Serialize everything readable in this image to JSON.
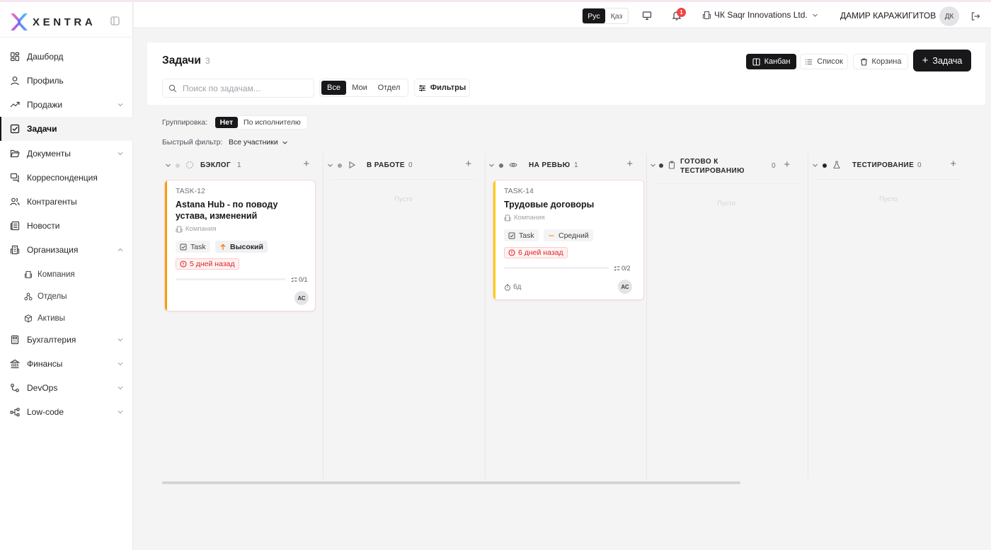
{
  "brand": {
    "name": "XENTRA"
  },
  "sidebar": {
    "items": [
      {
        "label": "Дашборд"
      },
      {
        "label": "Профиль"
      },
      {
        "label": "Продажи"
      },
      {
        "label": "Задачи"
      },
      {
        "label": "Документы"
      },
      {
        "label": "Корреспонденция"
      },
      {
        "label": "Контрагенты"
      },
      {
        "label": "Новости"
      },
      {
        "label": "Организация"
      },
      {
        "label": "Бухгалтерия"
      },
      {
        "label": "Финансы"
      },
      {
        "label": "DevOps"
      },
      {
        "label": "Low-code"
      }
    ],
    "org_sub": [
      {
        "label": "Компания"
      },
      {
        "label": "Отделы"
      },
      {
        "label": "Активы"
      }
    ],
    "active": "Задачи"
  },
  "header": {
    "lang_ru": "Рус",
    "lang_kz": "Қаз",
    "notifications": "1",
    "company": "ЧК Saqr Innovations Ltd.",
    "user": "ДАМИР КАРАЖИГИТОВ",
    "initials": "ДК"
  },
  "page": {
    "title": "Задачи",
    "count": "3",
    "search_placeholder": "Поиск по задачам...",
    "scope": {
      "all": "Все",
      "mine": "Мои",
      "dept": "Отдел"
    },
    "filters": "Фильтры",
    "views": {
      "kanban": "Канбан",
      "list": "Список",
      "trash": "Корзина"
    },
    "add_task": "Задача",
    "grouping_label": "Группировка:",
    "grouping": {
      "none": "Нет",
      "assignee": "По исполнителю"
    },
    "quick_label": "Быстрый фильтр:",
    "quick_value": "Все участники"
  },
  "columns": [
    {
      "name": "БЭКЛОГ",
      "count": "1"
    },
    {
      "name": "В РАБОТЕ",
      "count": "0",
      "empty": "Пусто"
    },
    {
      "name": "НА РЕВЬЮ",
      "count": "1"
    },
    {
      "name_line1": "ГОТОВО К",
      "name_line2": "ТЕСТИРОВАНИЮ",
      "count": "0",
      "empty": "Пусто"
    },
    {
      "name": "ТЕСТИРОВАНИЕ",
      "count": "0",
      "empty": "Пусто"
    }
  ],
  "cards": [
    {
      "id": "TASK-12",
      "title": "Astana Hub - по поводу устава, изменений",
      "company": "Компания",
      "type": "Task",
      "priority": "Высокий",
      "due": "5 дней назад",
      "subtasks": "0/1",
      "assignee": "АС",
      "accent": "#f59e0b"
    },
    {
      "id": "TASK-14",
      "title": "Трудовые договоры",
      "company": "Компания",
      "type": "Task",
      "priority": "Средний",
      "due": "6 дней назад",
      "subtasks": "0/2",
      "estimate": "6д",
      "assignee": "АС",
      "accent": "#facc15"
    }
  ],
  "colors": {
    "accent_dark": "#18181b",
    "danger": "#dc2626",
    "priority_high": "#f97316",
    "priority_mid": "#f59e0b"
  }
}
